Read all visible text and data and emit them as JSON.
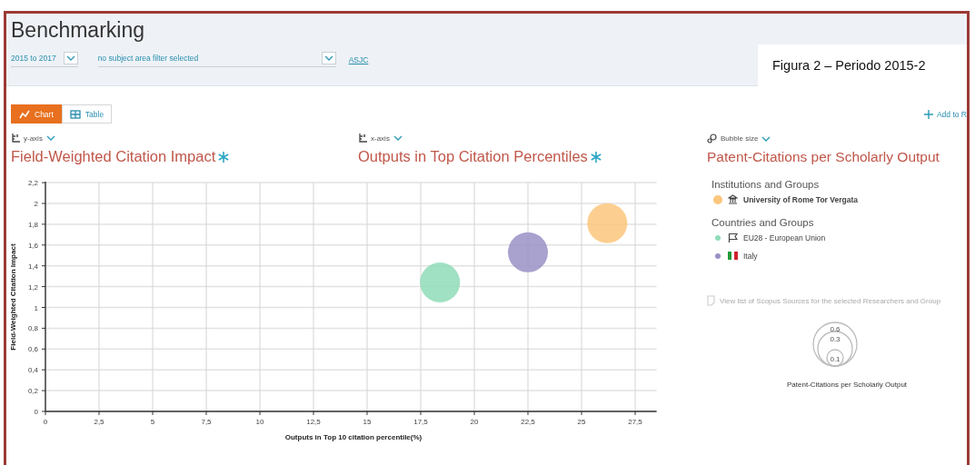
{
  "header": {
    "title": "Benchmarking",
    "filters": [
      {
        "kind": "dropdown",
        "value": "2015 to 2017"
      },
      {
        "kind": "dropdown",
        "value": "no subject area filter selected"
      },
      {
        "kind": "link",
        "label": "ASJC"
      }
    ]
  },
  "caption": "Figura 2 – Periodo 2015-2",
  "view_toggle": [
    {
      "kind": "chart",
      "label": "Chart",
      "selected": true
    },
    {
      "kind": "table",
      "label": "Table",
      "selected": false
    }
  ],
  "add_link": "Add to R",
  "axes": [
    {
      "kind": "axis",
      "selector": "y-axis",
      "title": "Field-Weighted Citation Impact"
    },
    {
      "kind": "axis",
      "selector": "x-axis",
      "title": "Outputs in Top Citation Percentiles"
    },
    {
      "kind": "bubble",
      "selector": "Bubble size",
      "title": "Patent-Citations per Scholarly Output"
    }
  ],
  "chart_data": {
    "type": "scatter",
    "grid": true,
    "xlabel": "Outputs in Top 10 citation percentile(%)",
    "ylabel": "Field-Weighted Citation Impact",
    "x": [
      18.4,
      22.5,
      26.2
    ],
    "series": [
      {
        "name": "University of Rome Tor Vergata",
        "color": "#fbc77c",
        "values": [
          null,
          null,
          1.81
        ]
      },
      {
        "name": "EU28 - European Union",
        "color": "#8fdcb8",
        "values": [
          1.24,
          null,
          null
        ]
      },
      {
        "name": "Italy",
        "color": "#9a90c6",
        "values": [
          null,
          1.53,
          null
        ]
      }
    ],
    "xlim": [
      0,
      28.5
    ],
    "ylim": [
      0,
      2.2
    ],
    "xticks": [
      0,
      {
        "value": 2.5,
        "label": "2,5"
      },
      5,
      {
        "value": 7.5,
        "label": "7,5"
      },
      10,
      {
        "value": 12.5,
        "label": "12,5"
      },
      15,
      {
        "value": 17.5,
        "label": "17,5"
      },
      20,
      {
        "value": 22.5,
        "label": "22,5"
      },
      25,
      {
        "value": 27.5,
        "label": "27,5"
      }
    ],
    "yticks": [
      0,
      {
        "value": 0.2,
        "label": "0,2"
      },
      {
        "value": 0.4,
        "label": "0,4"
      },
      {
        "value": 0.6,
        "label": "0,6"
      },
      {
        "value": 0.8,
        "label": "0,8"
      },
      1,
      {
        "value": 1.2,
        "label": "1,2"
      },
      {
        "value": 1.4,
        "label": "1,4"
      },
      {
        "value": 1.6,
        "label": "1,6"
      },
      {
        "value": 1.8,
        "label": "1,8"
      },
      2,
      {
        "value": 2.2,
        "label": "2,2"
      }
    ]
  },
  "legend": {
    "groups": [
      {
        "heading": "Institutions and Groups",
        "items": [
          {
            "kind": "institution"
          }
        ]
      },
      {
        "heading": "Countries and Groups",
        "items": [
          {
            "kind": "region"
          },
          {
            "kind": "country"
          }
        ]
      }
    ],
    "sources_link": "View list of Scopus Sources for the selected Researchers and Group",
    "size_legend": {
      "labels": [
        "0.6",
        "0.3",
        "0.1"
      ],
      "title": "Patent-Citations per Scholarly Output"
    }
  }
}
